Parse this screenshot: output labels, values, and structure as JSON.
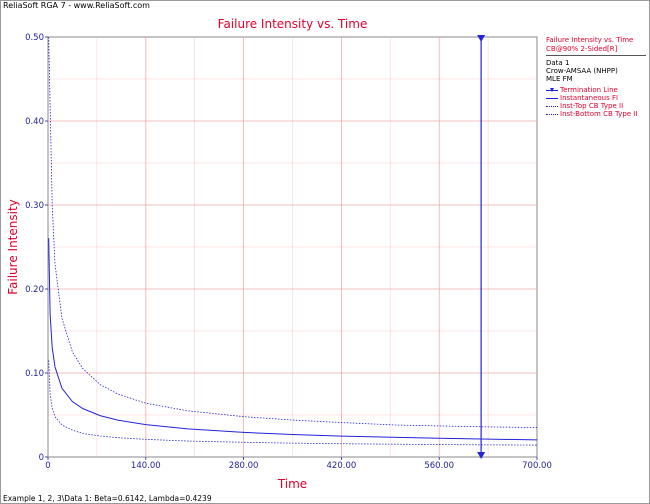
{
  "app": {
    "window_title": "ReliaSoft RGA 7 - www.ReliaSoft.com",
    "status_text": "Example 1, 2, 3\\Data 1: Beta=0.6142, Lambda=0.4239"
  },
  "legend": {
    "title": "Failure Intensity vs. Time",
    "subtitle": "CB@90% 2-Sided[R]",
    "info": [
      "Data 1",
      "Crow-AMSAA (NHPP)",
      "MLE FM"
    ],
    "entries": [
      {
        "label": "Termination Line",
        "style": "marker"
      },
      {
        "label": "Instantaneous FI",
        "style": "solid"
      },
      {
        "label": "Inst-Top CB Type II",
        "style": "dotted"
      },
      {
        "label": "Inst-Bottom CB Type II",
        "style": "dotted"
      }
    ]
  },
  "colors": {
    "curve": "#2323d9",
    "grid": "#f2a0a0",
    "axis_text": "#2323a0",
    "title": "#e4002b"
  },
  "chart_data": {
    "type": "line",
    "title": "Failure Intensity vs. Time",
    "xlabel": "Time",
    "ylabel": "Failure Intensity",
    "xlim": [
      0,
      700
    ],
    "ylim": [
      0,
      0.5
    ],
    "xticks": [
      0,
      140,
      280,
      420,
      560,
      700
    ],
    "yticks": [
      0,
      0.1,
      0.2,
      0.3,
      0.4,
      0.5
    ],
    "xtick_labels": [
      "0",
      "140.00",
      "280.00",
      "420.00",
      "560.00",
      "700.00"
    ],
    "ytick_labels": [
      "0",
      "0.10",
      "0.20",
      "0.30",
      "0.40",
      "0.50"
    ],
    "grid": true,
    "termination_line_x": 620,
    "series": [
      {
        "name": "Instantaneous FI",
        "style": "solid",
        "x": [
          1,
          3,
          6,
          10,
          20,
          35,
          50,
          75,
          100,
          140,
          200,
          280,
          350,
          420,
          500,
          560,
          620,
          700
        ],
        "y": [
          0.2604,
          0.1704,
          0.1304,
          0.1073,
          0.0818,
          0.0659,
          0.0576,
          0.0491,
          0.0439,
          0.0385,
          0.0335,
          0.0293,
          0.0268,
          0.0249,
          0.0233,
          0.0223,
          0.0214,
          0.0204
        ]
      },
      {
        "name": "Inst-Top CB Type II",
        "style": "dotted",
        "x": [
          1,
          3,
          6,
          10,
          20,
          35,
          50,
          75,
          100,
          140,
          200,
          280,
          350,
          420,
          500,
          560,
          620,
          700
        ],
        "y": [
          0.5,
          0.42,
          0.3,
          0.23,
          0.165,
          0.125,
          0.105,
          0.086,
          0.075,
          0.064,
          0.055,
          0.048,
          0.044,
          0.041,
          0.038,
          0.037,
          0.036,
          0.035
        ]
      },
      {
        "name": "Inst-Bottom CB Type II",
        "style": "dotted",
        "x": [
          1,
          3,
          6,
          10,
          20,
          35,
          50,
          75,
          100,
          140,
          200,
          280,
          350,
          420,
          500,
          560,
          620,
          700
        ],
        "y": [
          0.115,
          0.075,
          0.058,
          0.048,
          0.038,
          0.032,
          0.028,
          0.025,
          0.023,
          0.021,
          0.019,
          0.0175,
          0.0165,
          0.0158,
          0.0152,
          0.0148,
          0.0145,
          0.0142
        ]
      }
    ]
  }
}
